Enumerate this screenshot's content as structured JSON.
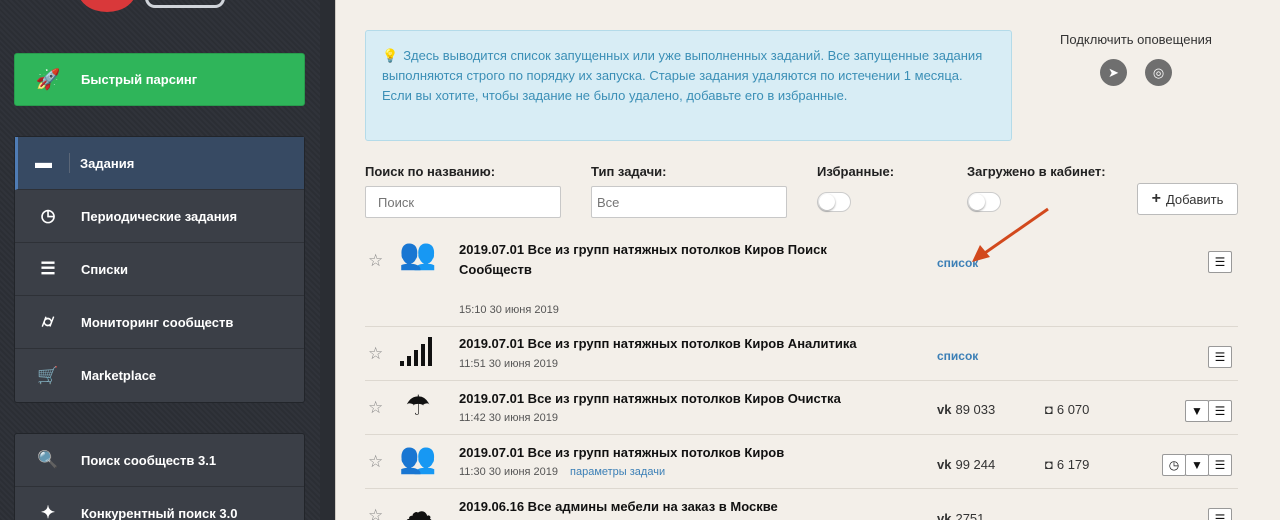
{
  "sidebar": {
    "fast_parse": "Быстрый парсинг",
    "menu1": [
      {
        "label": "Задания",
        "icon": "tasks-icon",
        "active": true
      },
      {
        "label": "Периодические задания",
        "icon": "clock-icon"
      },
      {
        "label": "Списки",
        "icon": "list-icon"
      },
      {
        "label": "Мониторинг сообществ",
        "icon": "binoculars-icon"
      },
      {
        "label": "Marketplace",
        "icon": "cart-icon"
      }
    ],
    "menu2": [
      {
        "label": "Поиск сообществ 3.1",
        "icon": "search-icon"
      },
      {
        "label": "Конкурентный поиск 3.0",
        "icon": "magic-wand-icon"
      }
    ]
  },
  "info": {
    "text": "Здесь выводится список запущенных или уже выполненных заданий. Все запущенные задания выполняются строго по порядку их запуска. Старые задания удаляются по истечении 1 месяца. Если вы хотите, чтобы задание не было удалено, добавьте его в избранные."
  },
  "notify": {
    "label": "Подключить оповещения"
  },
  "filters": {
    "search_label": "Поиск по названию:",
    "search_placeholder": "Поиск",
    "type_label": "Тип задачи:",
    "type_placeholder": "Все",
    "favorites_label": "Избранные:",
    "loaded_label": "Загружено в кабинет:",
    "add_label": "Добавить"
  },
  "tasks": [
    {
      "title": "2019.07.01 Все из групп натяжных потолков Киров Поиск Сообществ",
      "date": "15:10 30 июня 2019",
      "link": "список",
      "icon": "group-icon"
    },
    {
      "title": "2019.07.01 Все из групп натяжных потолков Киров Аналитика",
      "date": "11:51 30 июня 2019",
      "link": "список",
      "icon": "signal-icon"
    },
    {
      "title": "2019.07.01 Все из групп натяжных потолков Киров Очистка",
      "date": "11:42 30 июня 2019",
      "vk": "89 033",
      "ig": "6 070",
      "icon": "umbrella-icon"
    },
    {
      "title": "2019.07.01 Все из групп натяжных потолков Киров",
      "date": "11:30 30 июня 2019",
      "params": "параметры задачи",
      "vk": "99 244",
      "ig": "6 179",
      "icon": "group-icon"
    },
    {
      "title": "2019.06.16 Все админы мебели на заказ в Москве",
      "vk": "2751",
      "icon": "cloud-upload-icon"
    }
  ]
}
